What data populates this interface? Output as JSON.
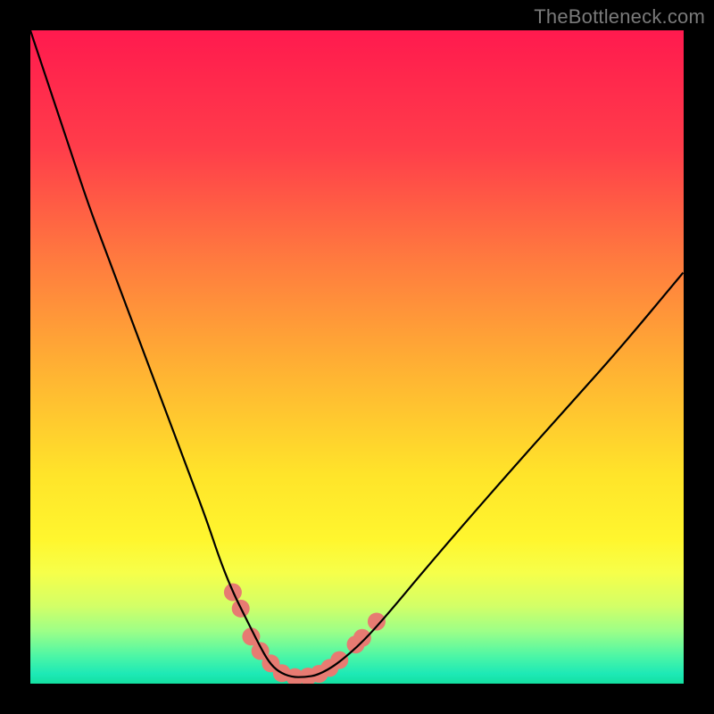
{
  "watermark": "TheBottleneck.com",
  "chart_data": {
    "type": "line",
    "title": "",
    "xlabel": "",
    "ylabel": "",
    "xlim": [
      0,
      100
    ],
    "ylim": [
      0,
      100
    ],
    "gradient_stops": [
      {
        "offset": 0.0,
        "color": "#ff1a4e"
      },
      {
        "offset": 0.18,
        "color": "#ff3d4a"
      },
      {
        "offset": 0.35,
        "color": "#ff7a3f"
      },
      {
        "offset": 0.52,
        "color": "#ffb233"
      },
      {
        "offset": 0.68,
        "color": "#ffe42a"
      },
      {
        "offset": 0.78,
        "color": "#fff62e"
      },
      {
        "offset": 0.83,
        "color": "#f6ff4a"
      },
      {
        "offset": 0.88,
        "color": "#d4ff66"
      },
      {
        "offset": 0.92,
        "color": "#9cff88"
      },
      {
        "offset": 0.958,
        "color": "#4cf6a6"
      },
      {
        "offset": 0.985,
        "color": "#1de9b6"
      },
      {
        "offset": 1.0,
        "color": "#14e0a0"
      }
    ],
    "series": [
      {
        "name": "bottleneck-curve",
        "x": [
          0,
          3,
          6,
          9,
          12,
          15,
          18,
          21,
          24,
          27,
          29,
          31,
          33,
          35,
          36.5,
          38,
          40,
          42,
          44,
          47,
          51,
          55,
          60,
          66,
          73,
          81,
          90,
          100
        ],
        "y": [
          100,
          91,
          82,
          73,
          65,
          57,
          49,
          41,
          33,
          25,
          19,
          14,
          10,
          6,
          3.3,
          1.8,
          1.0,
          1.0,
          1.3,
          3.0,
          6.5,
          11,
          17,
          24,
          32,
          41,
          51,
          63
        ]
      }
    ],
    "markers": {
      "name": "highlight-points",
      "color": "#e77b72",
      "radius": 10,
      "points": [
        {
          "x": 31.0,
          "y": 14.0
        },
        {
          "x": 32.2,
          "y": 11.5
        },
        {
          "x": 33.8,
          "y": 7.2
        },
        {
          "x": 35.2,
          "y": 5.0
        },
        {
          "x": 36.8,
          "y": 3.1
        },
        {
          "x": 38.5,
          "y": 1.6
        },
        {
          "x": 40.5,
          "y": 1.0
        },
        {
          "x": 42.5,
          "y": 1.1
        },
        {
          "x": 44.2,
          "y": 1.5
        },
        {
          "x": 45.8,
          "y": 2.4
        },
        {
          "x": 47.3,
          "y": 3.6
        },
        {
          "x": 49.8,
          "y": 6.0
        },
        {
          "x": 50.8,
          "y": 7.0
        },
        {
          "x": 53.0,
          "y": 9.5
        }
      ]
    }
  }
}
